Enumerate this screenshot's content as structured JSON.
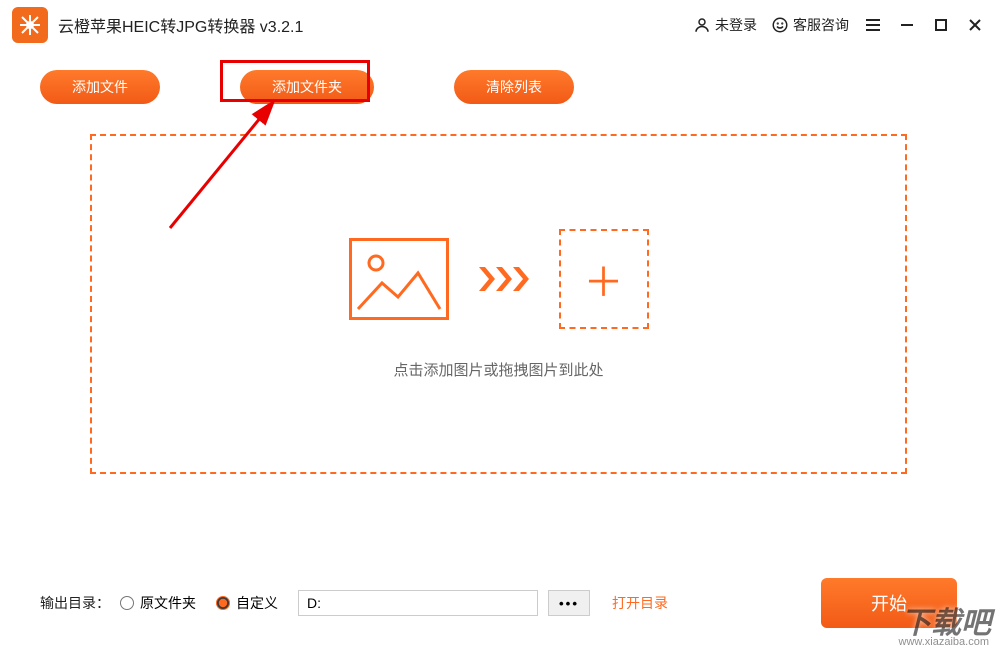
{
  "titlebar": {
    "app_title": "云橙苹果HEIC转JPG转换器 v3.2.1",
    "login_status": "未登录",
    "support_label": "客服咨询"
  },
  "toolbar": {
    "add_file_label": "添加文件",
    "add_folder_label": "添加文件夹",
    "clear_list_label": "清除列表"
  },
  "dropzone": {
    "hint_text": "点击添加图片或拖拽图片到此处"
  },
  "footer": {
    "output_label": "输出目录：",
    "radio_original_label": "原文件夹",
    "radio_custom_label": "自定义",
    "custom_path_value": "D:",
    "browse_btn_label": "•••",
    "open_dir_label": "打开目录",
    "start_btn_label": "开始",
    "output_mode_selected": "custom"
  },
  "watermark": {
    "main": "下载吧",
    "sub": "www.xiazaiba.com"
  }
}
